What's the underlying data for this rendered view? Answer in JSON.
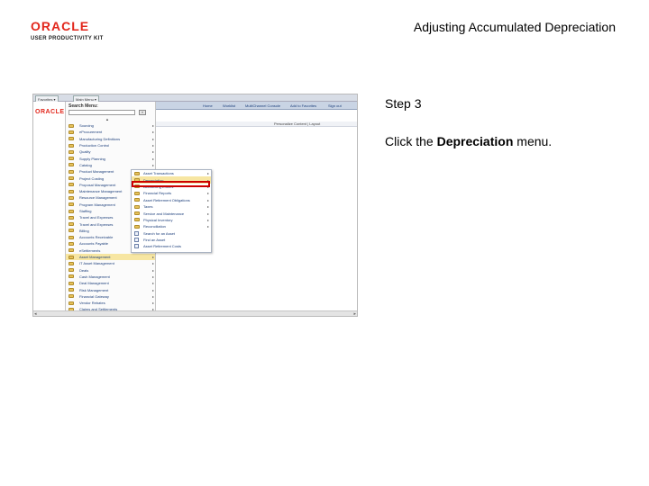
{
  "header": {
    "logo_brand": "ORACLE",
    "logo_product": "USER PRODUCTIVITY KIT",
    "title": "Adjusting Accumulated Depreciation"
  },
  "instructions": {
    "step": "Step 3",
    "prefix": "Click the ",
    "target": "Depreciation",
    "suffix": " menu."
  },
  "screenshot": {
    "tabs": [
      "Favorites ▾",
      "Main Menu ▾"
    ],
    "mini_logo": "ORACLE",
    "nav_links": [
      "Home",
      "Worklist",
      "MultiChannel Console",
      "Add to Favorites",
      "Sign out"
    ],
    "sub_bar_text": "Personalize Content  |  Layout",
    "menu": {
      "title": "Search Menu:",
      "search_button": "»",
      "scroll_up": "▲",
      "items": [
        {
          "label": "Sourcing",
          "arrow": "▸"
        },
        {
          "label": "eProcurement",
          "arrow": "▸"
        },
        {
          "label": "Manufacturing Definitions",
          "arrow": "▸"
        },
        {
          "label": "Production Control",
          "arrow": "▸"
        },
        {
          "label": "Quality",
          "arrow": "▸"
        },
        {
          "label": "Supply Planning",
          "arrow": "▸"
        },
        {
          "label": "Catalog",
          "arrow": "▸"
        },
        {
          "label": "Product Management",
          "arrow": "▸"
        },
        {
          "label": "Project Costing",
          "arrow": "▸"
        },
        {
          "label": "Proposal Management",
          "arrow": "▸"
        },
        {
          "label": "Maintenance Management",
          "arrow": "▸"
        },
        {
          "label": "Resource Management",
          "arrow": "▸"
        },
        {
          "label": "Program Management",
          "arrow": "▸"
        },
        {
          "label": "Staffing",
          "arrow": "▸"
        },
        {
          "label": "Travel and Expenses",
          "arrow": "▸"
        },
        {
          "label": "Travel and Expenses",
          "arrow": "▸"
        },
        {
          "label": "Billing",
          "arrow": "▸"
        },
        {
          "label": "Accounts Receivable",
          "arrow": "▸"
        },
        {
          "label": "Accounts Payable",
          "arrow": "▸"
        },
        {
          "label": "eSettlements",
          "arrow": "▸"
        },
        {
          "label": "Asset Management",
          "arrow": "▸"
        },
        {
          "label": "IT Asset Management",
          "arrow": "▸"
        },
        {
          "label": "Deals",
          "arrow": "▸"
        },
        {
          "label": "Cash Management",
          "arrow": "▸"
        },
        {
          "label": "Deal Management",
          "arrow": "▸"
        },
        {
          "label": "Risk Management",
          "arrow": "▸"
        },
        {
          "label": "Financial Gateway",
          "arrow": "▸"
        },
        {
          "label": "Vendor Rebates",
          "arrow": "▸"
        },
        {
          "label": "Claims and Settlements",
          "arrow": "▸"
        }
      ]
    },
    "submenu": {
      "items": [
        {
          "label": "Asset Transactions",
          "kind": "folder",
          "arrow": "▸"
        },
        {
          "label": "Depreciation",
          "kind": "folder",
          "arrow": "▸"
        },
        {
          "label": "Accounting Entries",
          "kind": "folder",
          "arrow": "▸"
        },
        {
          "label": "Financial Reports",
          "kind": "folder",
          "arrow": "▸"
        },
        {
          "label": "Asset Retirement Obligations",
          "kind": "folder",
          "arrow": "▸"
        },
        {
          "label": "Taxes",
          "kind": "folder",
          "arrow": "▸"
        },
        {
          "label": "Service and Maintenance",
          "kind": "folder",
          "arrow": "▸"
        },
        {
          "label": "Physical Inventory",
          "kind": "folder",
          "arrow": "▸"
        },
        {
          "label": "Reconciliation",
          "kind": "folder",
          "arrow": "▸"
        },
        {
          "label": "Search for an Asset",
          "kind": "doc",
          "arrow": ""
        },
        {
          "label": "Find an Asset",
          "kind": "doc",
          "arrow": ""
        },
        {
          "label": "Asset Retirement Costs",
          "kind": "doc",
          "arrow": ""
        }
      ]
    },
    "scroll_left": "◂",
    "scroll_right": "▸"
  }
}
